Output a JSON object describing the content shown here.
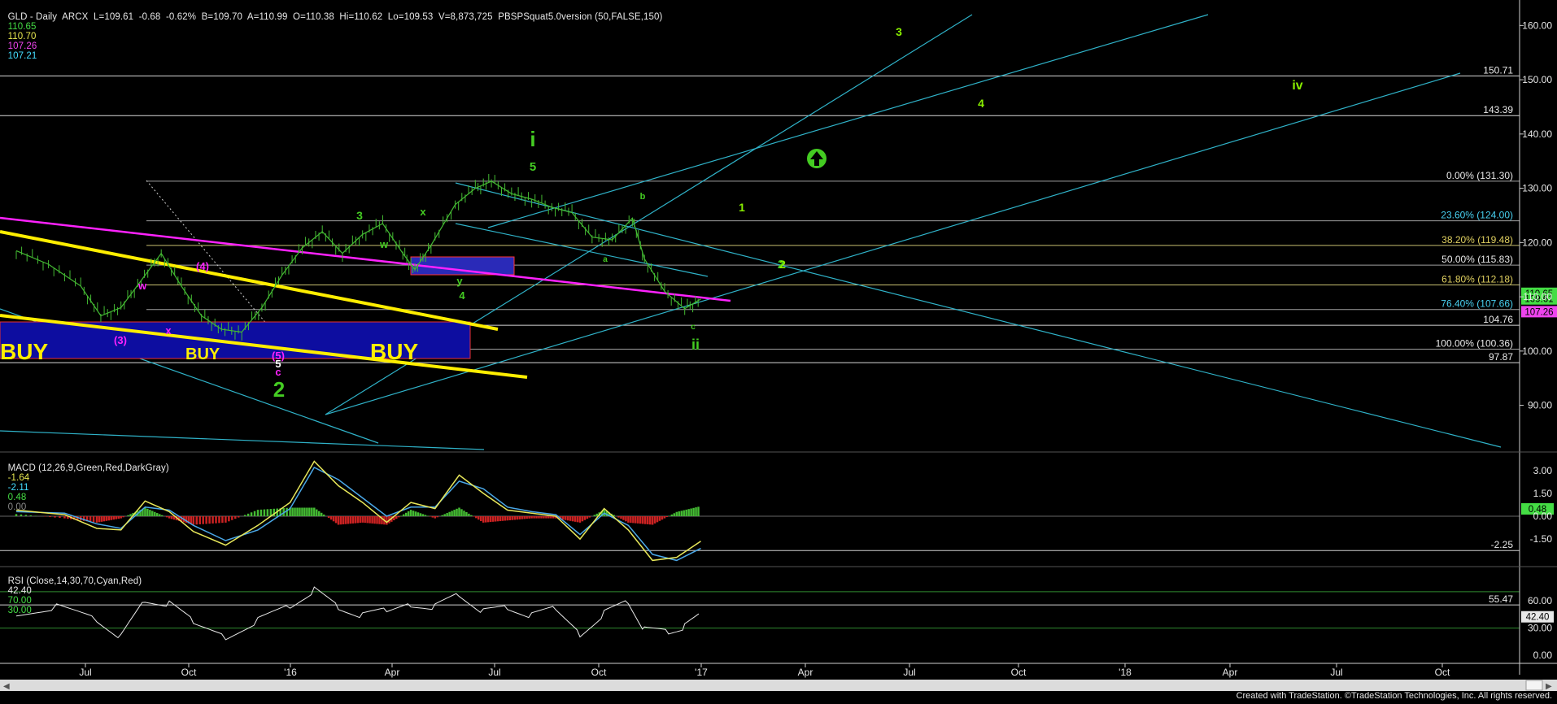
{
  "colors": {
    "background": "#000000",
    "grid_line": "#d8d8d8",
    "fib_line": "#a0a0a0",
    "fib_text": "#e8e8e8",
    "fib_gold": "#c8c070",
    "fib_gold_text": "#e0d060",
    "fib_cyan_text": "#48d0f0",
    "channel": "#2fb2c8",
    "yellow": "#ffee00",
    "magenta": "#ff22ff",
    "buy_box_fill": "#0d0da0",
    "buy_box_border": "#e83030",
    "small_box_fill": "#2a2ab8",
    "green_label": "#44cc22",
    "bright_green_label": "#88ee00",
    "price_bars": "#44bb33",
    "macd_line": "#e8e85a",
    "macd_signal": "#4aa8e8",
    "macd_hist_pos": "#44bb33",
    "macd_hist_neg": "#cc2222",
    "rsi_line": "#e8e8e8",
    "rsi_high": "#cc2222",
    "rsi_low": "#35a8d0",
    "header_text": "#e8e8e8",
    "header_value_green": "#44dd44",
    "header_value_yellow": "#e8e850",
    "header_value_magenta": "#ee44ee",
    "header_value_cyan": "#44ddff"
  },
  "header": {
    "main": "GLD - Daily  ARCX  L=109.61  -0.68  -0.62%  B=109.70  A=110.99  O=110.38  Hi=110.62  Lo=109.53  V=8,873,725  PBSPSquat5.0version (50,FALSE,150)",
    "v1": "110.65",
    "v2": "110.70",
    "v3": "107.26",
    "v4": "107.21",
    "macd": "MACD (12,26,9,Green,Red,DarkGray)",
    "macd_v1": "-1.64",
    "macd_v2": "-2.11",
    "macd_v3": "0.48",
    "macd_v4": "0.00",
    "rsi": "RSI (Close,14,30,70,Cyan,Red)",
    "rsi_v1": "42.40",
    "rsi_v2": "70.00",
    "rsi_v3": "30.00"
  },
  "footer_credit": "Created with TradeStation. ©TradeStation Technologies, Inc. All rights reserved.",
  "chart_data": [
    {
      "type": "line",
      "title": "GLD - Daily ARCX",
      "price_axis_ticks": [
        "160.00",
        "150.00",
        "140.00",
        "130.00",
        "120.00",
        "110.00",
        "100.00",
        "90.00"
      ],
      "ylim": [
        82,
        162
      ],
      "x_ticks": [
        "Jul",
        "Oct",
        "'16",
        "Apr",
        "Jul",
        "Oct",
        "'17",
        "Apr",
        "Jul",
        "Oct",
        "'18",
        "Apr",
        "Jul",
        "Oct"
      ],
      "close_series_path": [
        [
          0,
          118.5
        ],
        [
          0.8,
          116
        ],
        [
          1.6,
          112
        ],
        [
          2.1,
          106.5
        ],
        [
          2.6,
          108
        ],
        [
          3.1,
          113
        ],
        [
          3.6,
          118
        ],
        [
          4.1,
          112
        ],
        [
          4.6,
          106.5
        ],
        [
          5.1,
          104
        ],
        [
          5.6,
          103.5
        ],
        [
          6.1,
          108
        ],
        [
          6.6,
          114
        ],
        [
          7.1,
          119
        ],
        [
          7.6,
          122
        ],
        [
          8.1,
          118
        ],
        [
          8.6,
          121.5
        ],
        [
          9.1,
          123.5
        ],
        [
          9.6,
          118
        ],
        [
          9.9,
          115
        ],
        [
          10.3,
          119.5
        ],
        [
          10.9,
          127
        ],
        [
          11.4,
          130
        ],
        [
          11.8,
          131.3
        ],
        [
          12.3,
          129
        ],
        [
          12.8,
          128
        ],
        [
          13.3,
          126.5
        ],
        [
          13.8,
          125.5
        ],
        [
          14.3,
          121
        ],
        [
          14.8,
          120.5
        ],
        [
          15.3,
          124.5
        ],
        [
          15.6,
          117
        ],
        [
          16.1,
          111
        ],
        [
          16.6,
          107.8
        ],
        [
          17.0,
          109.6
        ]
      ],
      "horizontal_levels": [
        {
          "value": 150.71,
          "label": "150.71"
        },
        {
          "value": 143.39,
          "label": "143.39"
        },
        {
          "value": 131.3,
          "label": "0.00% (131.30)",
          "kind": "fib"
        },
        {
          "value": 124.0,
          "label": "23.60% (124.00)",
          "kind": "fib_cyan"
        },
        {
          "value": 119.48,
          "label": "38.20% (119.48)",
          "kind": "fib_gold"
        },
        {
          "value": 115.83,
          "label": "50.00% (115.83)",
          "kind": "fib"
        },
        {
          "value": 112.18,
          "label": "61.80% (112.18)",
          "kind": "fib_gold"
        },
        {
          "value": 107.66,
          "label": "76.40% (107.66)",
          "kind": "fib_cyan"
        },
        {
          "value": 104.76,
          "label": "104.76"
        },
        {
          "value": 100.36,
          "label": "100.00% (100.36)",
          "kind": "fib"
        },
        {
          "value": 97.87,
          "label": "97.87"
        }
      ],
      "price_badges": [
        {
          "label": "110.65",
          "color": "#44dd44"
        },
        {
          "label": "109.61",
          "color": "#44dd44"
        },
        {
          "label": "107.26",
          "color": "#ee44ee"
        }
      ],
      "annotations": {
        "buy": [
          "BUY",
          "BUY",
          "BUY"
        ],
        "wave_green": [
          "i",
          "5",
          "3",
          "x",
          "w",
          "y",
          "4",
          "2",
          "ii",
          "c",
          "a",
          "b"
        ],
        "wave_magenta": [
          "w",
          "x",
          "(3)",
          "(4)",
          "(5)",
          "c"
        ],
        "wave_white": [
          "5"
        ],
        "forecast_labels": [
          "3",
          "4",
          "1",
          "2",
          "iv"
        ]
      }
    },
    {
      "type": "line",
      "title": "MACD (12,26,9,Green,Red,DarkGray)",
      "price_axis_ticks": [
        "3.00",
        "1.50",
        "0.00",
        "-1.50"
      ],
      "ylim": [
        -3.2,
        4.0
      ],
      "series": [
        {
          "name": "MACD",
          "points": [
            [
              0,
              0.4
            ],
            [
              1.2,
              0.1
            ],
            [
              2.0,
              -0.8
            ],
            [
              2.6,
              -0.9
            ],
            [
              3.2,
              1.0
            ],
            [
              3.8,
              0.3
            ],
            [
              4.4,
              -1.0
            ],
            [
              5.2,
              -1.9
            ],
            [
              6.0,
              -0.6
            ],
            [
              6.8,
              0.9
            ],
            [
              7.4,
              3.6
            ],
            [
              8.0,
              2.0
            ],
            [
              8.6,
              0.9
            ],
            [
              9.2,
              -0.4
            ],
            [
              9.8,
              0.9
            ],
            [
              10.4,
              0.5
            ],
            [
              11.0,
              2.7
            ],
            [
              11.6,
              1.5
            ],
            [
              12.2,
              0.4
            ],
            [
              12.8,
              0.2
            ],
            [
              13.4,
              0.0
            ],
            [
              14.0,
              -1.5
            ],
            [
              14.6,
              0.5
            ],
            [
              15.2,
              -0.9
            ],
            [
              15.8,
              -2.9
            ],
            [
              16.4,
              -2.7
            ],
            [
              17.0,
              -1.64
            ]
          ]
        },
        {
          "name": "Signal",
          "points": [
            [
              0,
              0.3
            ],
            [
              1.2,
              0.2
            ],
            [
              2.0,
              -0.5
            ],
            [
              2.6,
              -0.8
            ],
            [
              3.2,
              0.6
            ],
            [
              3.8,
              0.4
            ],
            [
              4.4,
              -0.6
            ],
            [
              5.2,
              -1.6
            ],
            [
              6.0,
              -0.9
            ],
            [
              6.8,
              0.5
            ],
            [
              7.4,
              3.2
            ],
            [
              8.0,
              2.4
            ],
            [
              8.6,
              1.2
            ],
            [
              9.2,
              0.0
            ],
            [
              9.8,
              0.6
            ],
            [
              10.4,
              0.6
            ],
            [
              11.0,
              2.3
            ],
            [
              11.6,
              1.8
            ],
            [
              12.2,
              0.6
            ],
            [
              12.8,
              0.3
            ],
            [
              13.4,
              0.1
            ],
            [
              14.0,
              -1.2
            ],
            [
              14.6,
              0.2
            ],
            [
              15.2,
              -0.6
            ],
            [
              15.8,
              -2.5
            ],
            [
              16.4,
              -2.9
            ],
            [
              17.0,
              -2.11
            ]
          ]
        }
      ],
      "levels": [
        {
          "value": -2.25,
          "label": "-2.25"
        }
      ],
      "badges": [
        {
          "label": "0.48",
          "color": "#44dd44"
        }
      ]
    },
    {
      "type": "line",
      "title": "RSI (Close,14,30,70,Cyan,Red)",
      "price_axis_ticks": [
        "60.00",
        "30.00",
        "0.00"
      ],
      "ylim": [
        -8,
        95
      ],
      "series": [
        {
          "name": "RSI",
          "points": [
            [
              0,
              48
            ],
            [
              1.0,
              55
            ],
            [
              2.0,
              40
            ],
            [
              2.6,
              20
            ],
            [
              3.2,
              60
            ],
            [
              3.8,
              55
            ],
            [
              4.4,
              35
            ],
            [
              5.2,
              22
            ],
            [
              6.0,
              40
            ],
            [
              6.8,
              55
            ],
            [
              7.4,
              72
            ],
            [
              8.0,
              52
            ],
            [
              8.6,
              42
            ],
            [
              9.2,
              48
            ],
            [
              9.8,
              58
            ],
            [
              10.4,
              55
            ],
            [
              11.0,
              68
            ],
            [
              11.6,
              48
            ],
            [
              12.2,
              52
            ],
            [
              12.8,
              42
            ],
            [
              13.4,
              50
            ],
            [
              14.0,
              25
            ],
            [
              14.6,
              48
            ],
            [
              15.2,
              60
            ],
            [
              15.6,
              28
            ],
            [
              16.2,
              25
            ],
            [
              16.6,
              30
            ],
            [
              17.0,
              42.4
            ]
          ]
        }
      ],
      "levels": [
        {
          "value": 55.47,
          "label": "55.47"
        }
      ],
      "badges": [
        {
          "label": "42.40",
          "color": "#e8e8e8"
        }
      ]
    }
  ]
}
